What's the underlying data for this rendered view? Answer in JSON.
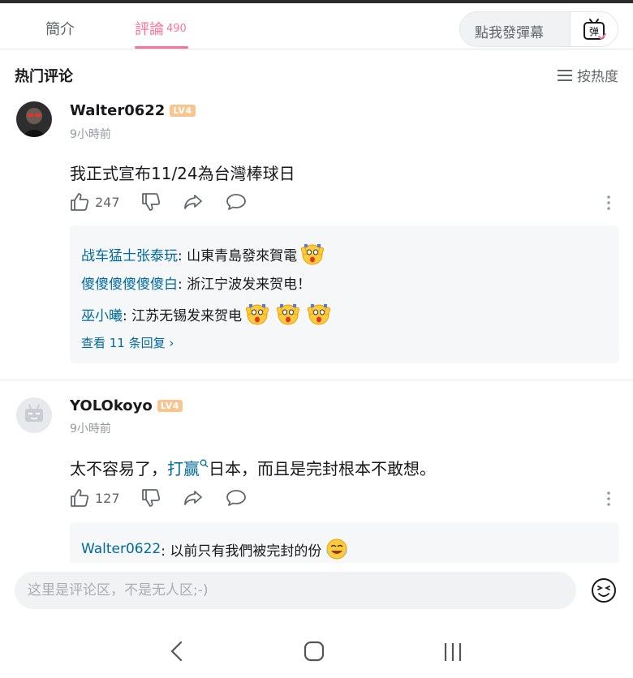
{
  "tabs": {
    "intro": "簡介",
    "comments": "評論",
    "comments_count": "490",
    "danmaku_placeholder": "點我發彈幕",
    "danmaku_button": "弹"
  },
  "section": {
    "title": "热门评论",
    "sort_label": "按热度"
  },
  "comments": [
    {
      "username": "Walter0622",
      "level": "LV4",
      "time": "9小時前",
      "content": "我正式宣布11/24為台灣棒球日",
      "likes": "247",
      "replies": [
        {
          "name": "战车猛士张泰玩",
          "text": ": 山東青島發來賀電"
        },
        {
          "name": "傻傻傻傻傻傻白",
          "text": ": 浙江宁波发来贺电！"
        },
        {
          "name": "巫小曦",
          "text": ": 江苏无锡发来贺电"
        }
      ],
      "view_more": "查看 11 条回复"
    },
    {
      "username": "YOLOkoyo",
      "level": "LV4",
      "time": "9小時前",
      "content_before": "太不容易了，",
      "content_link": "打赢",
      "content_after": "日本，而且是完封根本不敢想。",
      "likes": "127",
      "replies": [
        {
          "name": "Walter0622",
          "text": ": 以前只有我們被完封的份"
        }
      ]
    }
  ],
  "input": {
    "placeholder": "这里是评论区，不是无人区;-)"
  },
  "colors": {
    "accent": "#fb7299",
    "link": "#00699d",
    "level_badge": "#f9c58f"
  },
  "icons": [
    "thumb-up-icon",
    "thumb-down-icon",
    "share-icon",
    "comment-icon",
    "more-icon",
    "sort-icon",
    "emoji-icon",
    "tv-icon",
    "back-icon",
    "home-icon",
    "recent-apps-icon"
  ]
}
